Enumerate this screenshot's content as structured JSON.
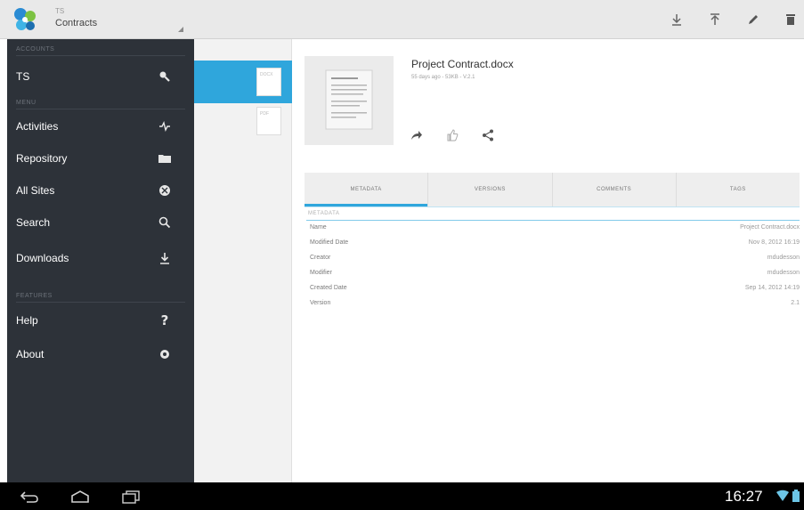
{
  "action_bar": {
    "subtitle": "TS",
    "title": "Contracts",
    "actions": [
      "download-icon",
      "upload-icon",
      "edit-icon",
      "delete-icon"
    ]
  },
  "drawer": {
    "sections": {
      "accounts": "ACCOUNTS",
      "menu": "MENU",
      "features": "FEATURES"
    },
    "account": {
      "label": "TS",
      "icon": "search-account-icon"
    },
    "menu_items": [
      {
        "label": "Activities",
        "icon": "activities-icon"
      },
      {
        "label": "Repository",
        "icon": "folder-icon"
      },
      {
        "label": "All Sites",
        "icon": "sites-icon"
      },
      {
        "label": "Search",
        "icon": "search-icon"
      },
      {
        "label": "Downloads",
        "icon": "download-icon"
      }
    ],
    "feature_items": [
      {
        "label": "Help",
        "icon": "help-icon"
      },
      {
        "label": "About",
        "icon": "gear-icon"
      }
    ]
  },
  "list": {
    "thumbs": [
      "DOCX",
      "PDF"
    ]
  },
  "document": {
    "name": "Project Contract.docx",
    "meta": "55 days ago - 53KB - V.2.1",
    "actions": [
      "share-icon",
      "like-icon",
      "share-alt-icon"
    ]
  },
  "tabs": [
    "METADATA",
    "VERSIONS",
    "COMMENTS",
    "TAGS"
  ],
  "active_tab": "METADATA",
  "metadata": {
    "section_label": "METADATA",
    "rows": [
      {
        "key": "Name",
        "value": "Project Contract.docx"
      },
      {
        "key": "Modified Date",
        "value": "Nov 8, 2012 16:19"
      },
      {
        "key": "Creator",
        "value": "mdudesson"
      },
      {
        "key": "Modifier",
        "value": "mdudesson"
      },
      {
        "key": "Created Date",
        "value": "Sep 14, 2012 14:19"
      },
      {
        "key": "Version",
        "value": "2.1"
      }
    ]
  },
  "system_bar": {
    "time": "16:27",
    "nav": [
      "back-icon",
      "home-icon",
      "recent-apps-icon"
    ]
  },
  "colors": {
    "accent": "#2fa6dc",
    "drawer_bg": "#2d3239",
    "action_bar": "#e9e9e9"
  }
}
